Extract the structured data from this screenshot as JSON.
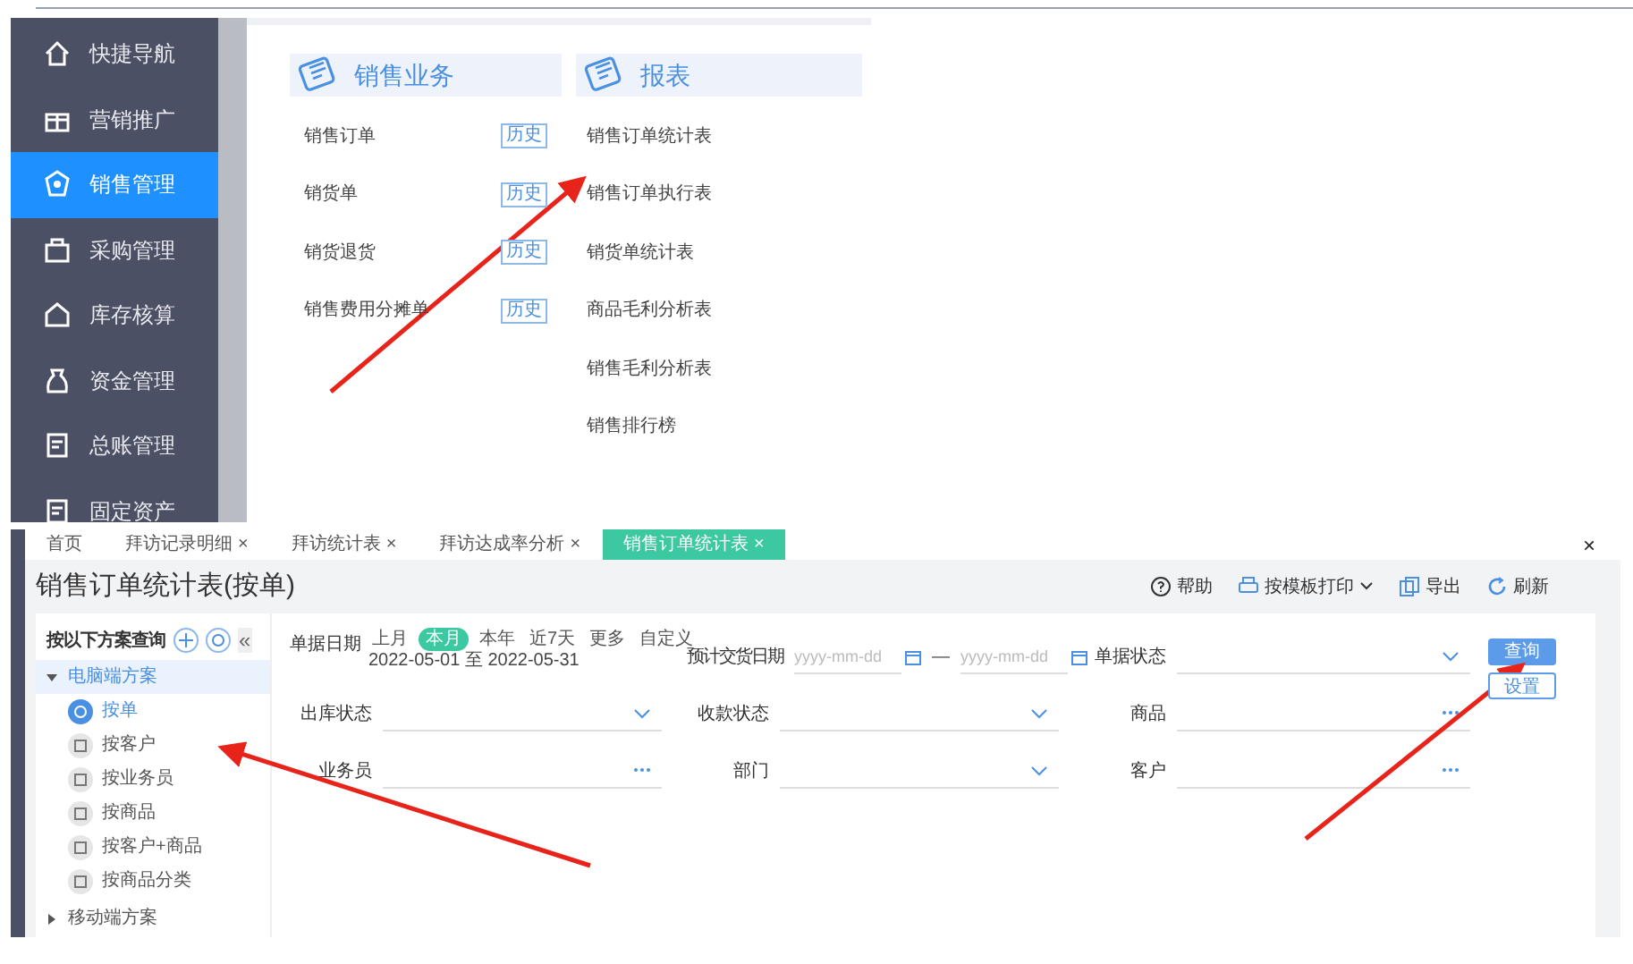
{
  "menu": {
    "items": [
      {
        "label": "快捷导航",
        "selected": false
      },
      {
        "label": "营销推广",
        "selected": false
      },
      {
        "label": "销售管理",
        "selected": true
      },
      {
        "label": "采购管理",
        "selected": false
      },
      {
        "label": "库存核算",
        "selected": false
      },
      {
        "label": "资金管理",
        "selected": false
      },
      {
        "label": "总账管理",
        "selected": false
      },
      {
        "label": "固定资产",
        "selected": false
      }
    ]
  },
  "sales_business": {
    "title": "销售业务",
    "items": [
      {
        "label": "销售订单",
        "history": "历史"
      },
      {
        "label": "销货单",
        "history": "历史"
      },
      {
        "label": "销货退货",
        "history": "历史"
      },
      {
        "label": "销售费用分摊单",
        "history": "历史"
      }
    ]
  },
  "reports": {
    "title": "报表",
    "items": [
      "销售订单统计表",
      "销售订单执行表",
      "销货单统计表",
      "商品毛利分析表",
      "销售毛利分析表",
      "销售排行榜"
    ]
  },
  "tabs": [
    {
      "label": "首页",
      "selected": false
    },
    {
      "label": "拜访记录明细",
      "close": "×",
      "selected": false
    },
    {
      "label": "拜访统计表",
      "close": "×",
      "selected": false
    },
    {
      "label": "拜访达成率分析",
      "close": "×",
      "selected": false
    },
    {
      "label": "销售订单统计表",
      "close": "×",
      "selected": true
    }
  ],
  "close_all": "×",
  "page_title": "销售订单统计表(按单)",
  "toolbar": [
    {
      "label": "帮助",
      "kind": "button"
    },
    {
      "label": "按模板打印",
      "kind": "dropdown"
    },
    {
      "label": "导出",
      "kind": "button"
    },
    {
      "label": "刷新",
      "kind": "button"
    }
  ],
  "scheme_panel": {
    "title": "按以下方案查询",
    "collapse": "«",
    "tree": [
      {
        "label": "电脑端方案",
        "expanded": true,
        "children": [
          {
            "label": "按单",
            "selected": true
          },
          {
            "label": "按客户",
            "selected": false
          },
          {
            "label": "按业务员",
            "selected": false
          },
          {
            "label": "按商品",
            "selected": false
          },
          {
            "label": "按客户+商品",
            "selected": false
          },
          {
            "label": "按商品分类",
            "selected": false
          }
        ]
      },
      {
        "label": "移动端方案",
        "expanded": false
      }
    ]
  },
  "filters": {
    "date": {
      "label": "单据日期",
      "presets": [
        {
          "label": "上月",
          "selected": false
        },
        {
          "label": "本月",
          "selected": true
        },
        {
          "label": "本年",
          "selected": false
        },
        {
          "label": "近7天",
          "selected": false
        },
        {
          "label": "更多",
          "selected": false
        },
        {
          "label": "自定义",
          "selected": false
        }
      ],
      "range": "2022-05-01 至 2022-05-31"
    },
    "delivery_date": {
      "label": "预计交货日期",
      "from_placeholder": "yyyy-mm-dd",
      "separator": "—",
      "to_placeholder": "yyyy-mm-dd"
    },
    "fields": [
      {
        "label": "单据状态",
        "kind": "select"
      },
      {
        "label": "出库状态",
        "kind": "select"
      },
      {
        "label": "收款状态",
        "kind": "select"
      },
      {
        "label": "商品",
        "kind": "lookup"
      },
      {
        "label": "业务员",
        "kind": "lookup"
      },
      {
        "label": "部门",
        "kind": "select"
      },
      {
        "label": "客户",
        "kind": "lookup"
      }
    ]
  },
  "buttons": {
    "query": "查询",
    "settings": "设置"
  }
}
